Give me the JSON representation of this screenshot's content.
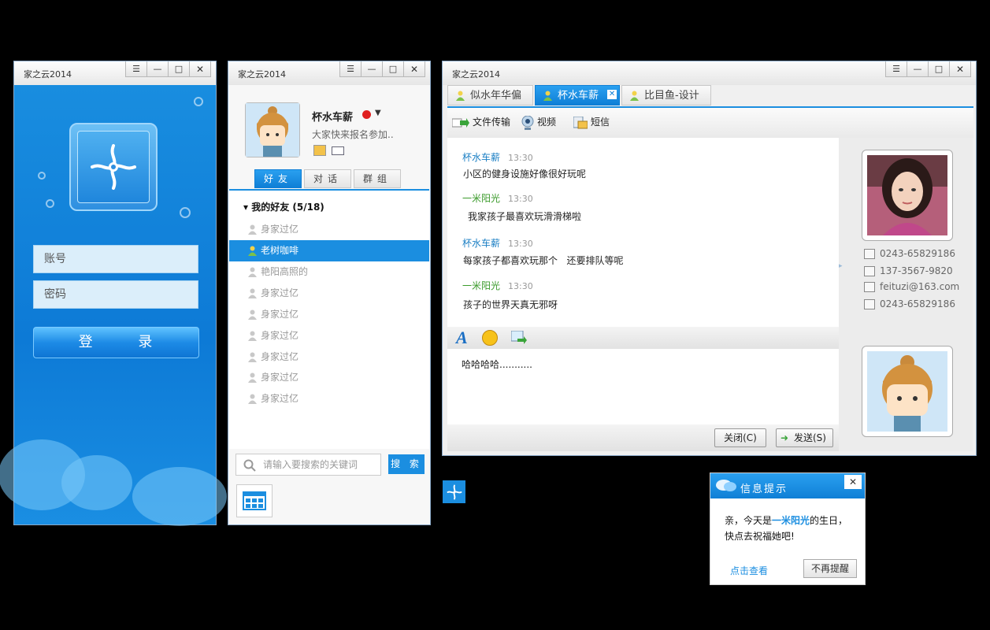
{
  "colors": {
    "accent": "#1b8ee0",
    "green_name": "#3a9a2a",
    "blue_name": "#1b7fc4"
  },
  "login": {
    "title": "家之云2014",
    "account_placeholder": "账号",
    "password_placeholder": "密码",
    "login_label": "登 录"
  },
  "friends": {
    "title": "家之云2014",
    "profile": {
      "name": "杯水车薪",
      "signature": "大家快来报名参加..",
      "status_icon": "busy-icon"
    },
    "tabs": [
      "好友",
      "对话",
      "群组"
    ],
    "group_label": "▾ 我的好友 (5/18)",
    "list": [
      {
        "name": "身家过亿",
        "selected": false
      },
      {
        "name": "老树咖啡",
        "selected": true
      },
      {
        "name": "艳阳高照的",
        "selected": false
      },
      {
        "name": "身家过亿",
        "selected": false
      },
      {
        "name": "身家过亿",
        "selected": false
      },
      {
        "name": "身家过亿",
        "selected": false
      },
      {
        "name": "身家过亿",
        "selected": false
      },
      {
        "name": "身家过亿",
        "selected": false
      },
      {
        "name": "身家过亿",
        "selected": false
      }
    ],
    "search_placeholder": "请输入要搜索的关键词",
    "search_label": "搜 索"
  },
  "chat": {
    "title": "家之云2014",
    "tabs": [
      {
        "label": "似水年华偏",
        "active": false
      },
      {
        "label": "杯水车薪",
        "active": true
      },
      {
        "label": "比目鱼-设计",
        "active": false
      }
    ],
    "tools": {
      "file": "文件传输",
      "video": "视频",
      "sms": "短信"
    },
    "messages": [
      {
        "sender": "杯水车薪",
        "time": "13:30",
        "text": "小区的健身设施好像很好玩呢",
        "color": "#1b7fc4"
      },
      {
        "sender": "一米阳光",
        "time": "13:30",
        "text": "我家孩子最喜欢玩滑滑梯啦",
        "color": "#3a9a2a"
      },
      {
        "sender": "杯水车薪",
        "time": "13:30",
        "text": "每家孩子都喜欢玩那个   还要排队等呢",
        "color": "#1b7fc4"
      },
      {
        "sender": "一米阳光",
        "time": "13:30",
        "text": "孩子的世界天真无邪呀",
        "color": "#3a9a2a"
      }
    ],
    "input_text": "哈哈哈哈...........",
    "close_label": "关闭(C)",
    "send_label": "发送(S)",
    "contact": {
      "phone": "0243-65829186",
      "mobile": "137-3567-9820",
      "email": "feituzi@163.com",
      "fax": "0243-65829186"
    }
  },
  "notice": {
    "title": "信息提示",
    "line1_prefix": "亲，今天是",
    "highlight": "一米阳光",
    "line1_suffix": "的生日，",
    "line2": "快点去祝福她吧!",
    "view_label": "点击查看",
    "dismiss_label": "不再提醒"
  }
}
